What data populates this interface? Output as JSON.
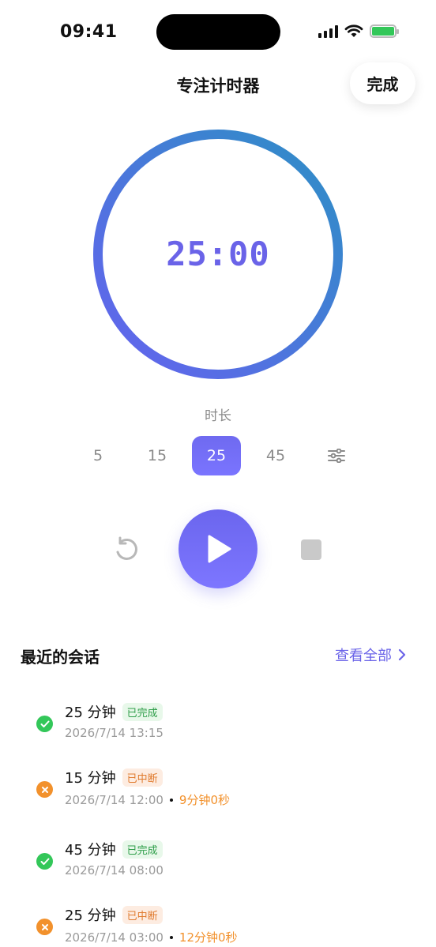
{
  "status_bar": {
    "time": "09:41"
  },
  "header": {
    "title": "专注计时器",
    "done_label": "完成"
  },
  "timer": {
    "display": "25:00",
    "ring_gradient": [
      "#2d8fc5",
      "#6562ef"
    ]
  },
  "duration": {
    "label": "时长",
    "options": [
      "5",
      "15",
      "25",
      "45"
    ],
    "selected": "25",
    "settings_icon": "sliders-icon"
  },
  "controls": {
    "reset_icon": "rotate-left-icon",
    "play_icon": "play-icon",
    "stop_icon": "stop-icon"
  },
  "recent": {
    "title": "最近的会话",
    "view_all_label": "查看全部",
    "sessions": [
      {
        "duration": "25 分钟",
        "status": "已完成",
        "date": "2026/7/14 13:15",
        "extra": ""
      },
      {
        "duration": "15 分钟",
        "status": "已中断",
        "date": "2026/7/14 12:00",
        "extra": "9分钟0秒"
      },
      {
        "duration": "45 分钟",
        "status": "已完成",
        "date": "2026/7/14 08:00",
        "extra": ""
      },
      {
        "duration": "25 分钟",
        "status": "已中断",
        "date": "2026/7/14 03:00",
        "extra": "12分钟0秒"
      }
    ]
  },
  "colors": {
    "accent": "#6a63e8",
    "success": "#33c759",
    "warning": "#f2912c"
  }
}
